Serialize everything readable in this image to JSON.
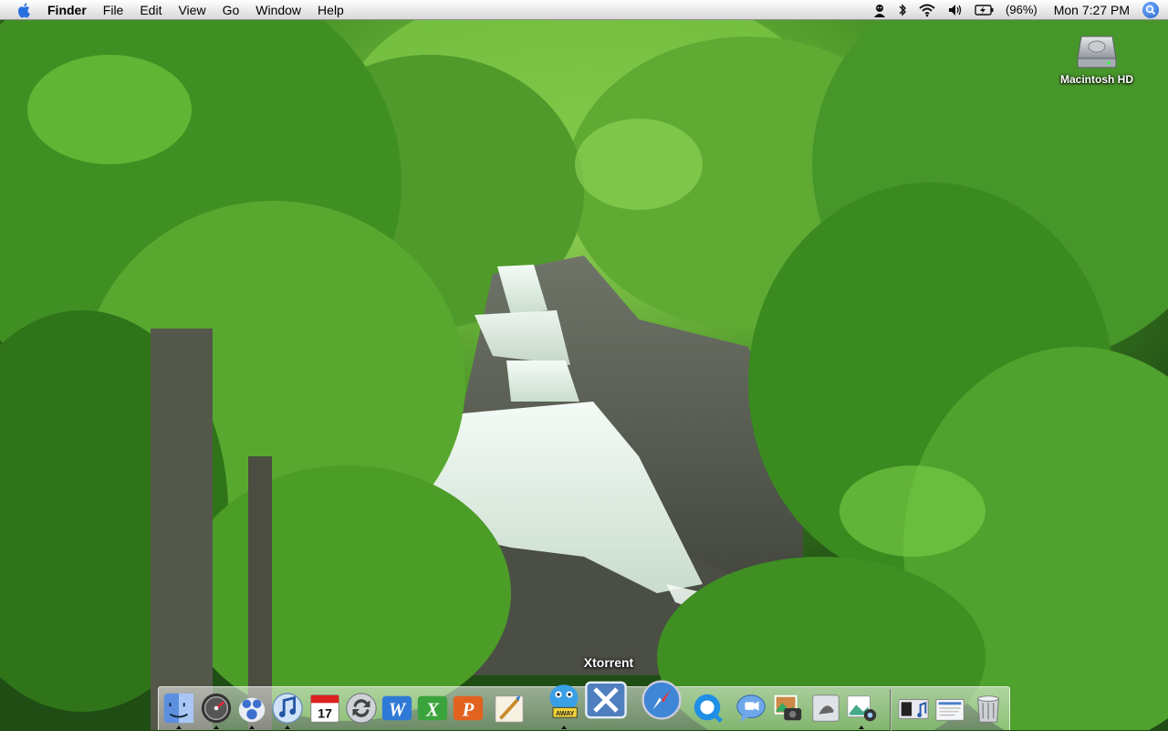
{
  "menubar": {
    "apple_icon": "apple-icon",
    "app_name": "Finder",
    "items": [
      "File",
      "Edit",
      "View",
      "Go",
      "Window",
      "Help"
    ],
    "status": {
      "icons": [
        "user-icon",
        "bluetooth-icon",
        "wifi-icon",
        "volume-icon",
        "battery-icon"
      ],
      "battery_percent": "(96%)",
      "clock": "Mon 7:27 PM",
      "spotlight_icon": "spotlight-icon"
    }
  },
  "desktop": {
    "wallpaper": "forest-waterfall",
    "icons": [
      {
        "name": "hard-drive-icon",
        "label": "Macintosh HD"
      }
    ]
  },
  "dock": {
    "tooltip": "Xtorrent",
    "apps": [
      {
        "icon": "finder-icon",
        "running": true
      },
      {
        "icon": "dashboard-icon",
        "running": true
      },
      {
        "icon": "gimp-icon",
        "running": true
      },
      {
        "icon": "itunes-icon",
        "running": true
      },
      {
        "icon": "ical-icon",
        "running": false
      },
      {
        "icon": "sync-icon",
        "running": false
      },
      {
        "icon": "word-icon",
        "running": false
      },
      {
        "icon": "excel-icon",
        "running": false
      },
      {
        "icon": "powerpoint-icon",
        "running": false
      },
      {
        "icon": "painter-icon",
        "running": false
      },
      {
        "icon": "adium-icon",
        "running": true
      },
      {
        "icon": "xtorrent-icon",
        "running": false
      },
      {
        "icon": "safari-icon",
        "running": false
      },
      {
        "icon": "quicktime-icon",
        "running": false
      },
      {
        "icon": "ichat-icon",
        "running": false
      },
      {
        "icon": "iphoto-icon",
        "running": false
      },
      {
        "icon": "preview-icon",
        "running": false
      },
      {
        "icon": "image-capture-icon",
        "running": true
      }
    ],
    "others": [
      {
        "icon": "music-folder-icon"
      },
      {
        "icon": "documents-stack-icon"
      },
      {
        "icon": "trash-icon"
      }
    ],
    "colors": {
      "accent": "#1f5fd1",
      "foliage": "#3f8f22"
    }
  }
}
